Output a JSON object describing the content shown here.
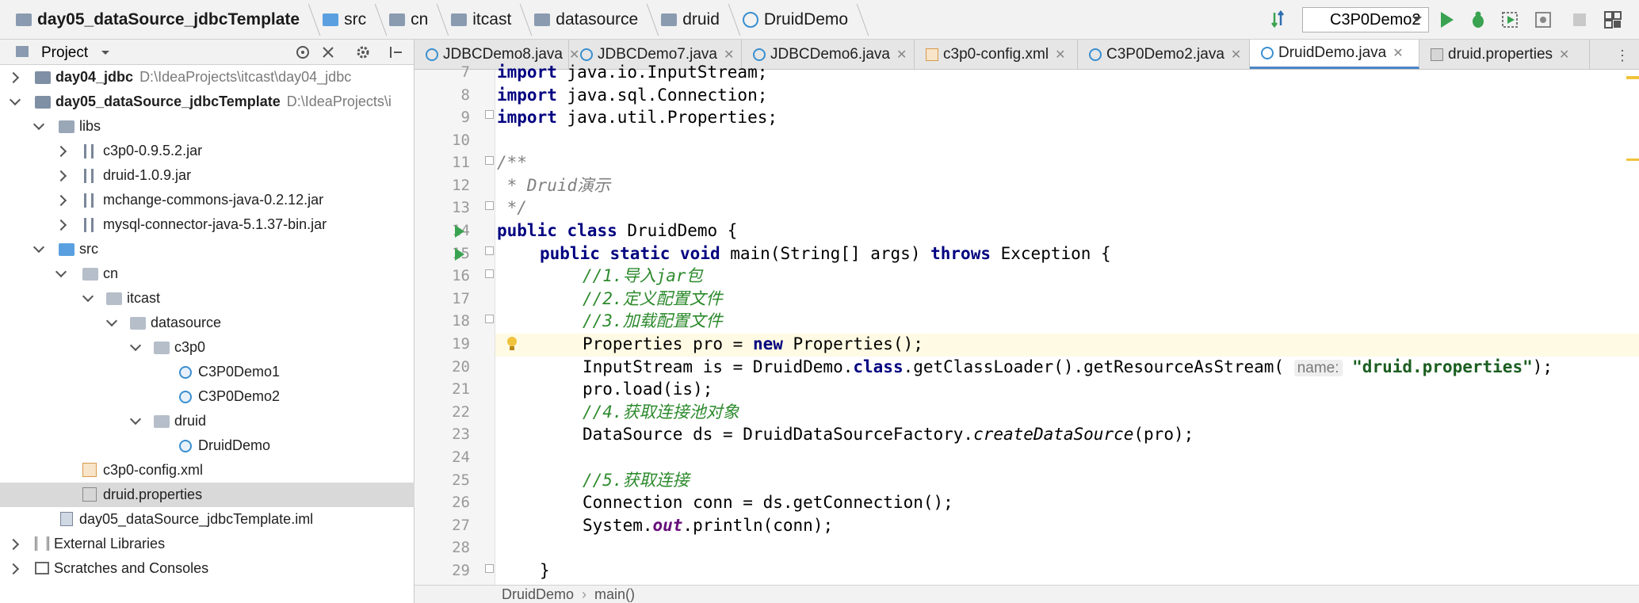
{
  "breadcrumb": {
    "items": [
      "day05_dataSource_jdbcTemplate",
      "src",
      "cn",
      "itcast",
      "datasource",
      "druid",
      "DruidDemo"
    ]
  },
  "toolbar": {
    "run_config": "C3P0Demo2"
  },
  "project_panel": {
    "title": "Project",
    "tree": [
      {
        "label": "day04_jdbc",
        "path": "D:\\IdeaProjects\\itcast\\day04_jdbc",
        "bold": true
      },
      {
        "label": "day05_dataSource_jdbcTemplate",
        "path": "D:\\IdeaProjects\\i",
        "bold": true
      },
      {
        "label": "libs"
      },
      {
        "label": "c3p0-0.9.5.2.jar"
      },
      {
        "label": "druid-1.0.9.jar"
      },
      {
        "label": "mchange-commons-java-0.2.12.jar"
      },
      {
        "label": "mysql-connector-java-5.1.37-bin.jar"
      },
      {
        "label": "src"
      },
      {
        "label": "cn"
      },
      {
        "label": "itcast"
      },
      {
        "label": "datasource"
      },
      {
        "label": "c3p0"
      },
      {
        "label": "C3P0Demo1"
      },
      {
        "label": "C3P0Demo2"
      },
      {
        "label": "druid"
      },
      {
        "label": "DruidDemo"
      },
      {
        "label": "c3p0-config.xml"
      },
      {
        "label": "druid.properties"
      },
      {
        "label": "day05_dataSource_jdbcTemplate.iml"
      },
      {
        "label": "External Libraries"
      },
      {
        "label": "Scratches and Consoles"
      }
    ]
  },
  "tabs": [
    "JDBCDemo8.java",
    "JDBCDemo7.java",
    "JDBCDemo6.java",
    "c3p0-config.xml",
    "C3P0Demo2.java",
    "DruidDemo.java",
    "druid.properties"
  ],
  "active_tab": "DruidDemo.java",
  "editor": {
    "line_numbers": [
      "7",
      "8",
      "9",
      "10",
      "11",
      "12",
      "13",
      "14",
      "15",
      "16",
      "17",
      "18",
      "19",
      "20",
      "21",
      "22",
      "23",
      "24",
      "25",
      "26",
      "27",
      "28",
      "29"
    ],
    "code": {
      "import_kw": "import",
      "l7": " java.io.InputStream;",
      "l8": " java.sql.Connection;",
      "l9": " java.util.Properties;",
      "l11": "/**",
      "l12": " * Druid演示",
      "l13": " */",
      "public_kw": "public",
      "class_kw": "class",
      "l14_name": " DruidDemo {",
      "static_kw": "static",
      "void_kw": "void",
      "l15_sig": " main(String[] args) ",
      "throws_kw": "throws",
      "l15_end": " Exception {",
      "l16": "//1.导入jar包",
      "l17": "//2.定义配置文件",
      "l18": "//3.加载配置文件",
      "l19_a": "Properties pro = ",
      "new_kw": "new",
      "l19_b": " Properties();",
      "l20_a": "InputStream is = DruidDemo.",
      "l20_b": ".getClassLoader().getResourceAsStream(",
      "l20_hint": "name:",
      "l20_str": "\"druid.properties\"",
      "l20_end": ");",
      "l21": "pro.load(is);",
      "l22": "//4.获取连接池对象",
      "l23_a": "DataSource ds = DruidDataSourceFactory.",
      "l23_m": "createDataSource",
      "l23_b": "(pro);",
      "l25": "//5.获取连接",
      "l26": "Connection conn = ds.getConnection();",
      "l27_a": "System.",
      "l27_out": "out",
      "l27_b": ".println(conn);",
      "l29": "}"
    }
  },
  "status_bar": {
    "crumbs": [
      "DruidDemo",
      "main()"
    ]
  },
  "colors": {
    "keyword": "#000080",
    "string": "#1b5e20",
    "comment": "#808080",
    "selected_row": "#d9d9d9",
    "active_tab_underline": "#4a86c8"
  }
}
